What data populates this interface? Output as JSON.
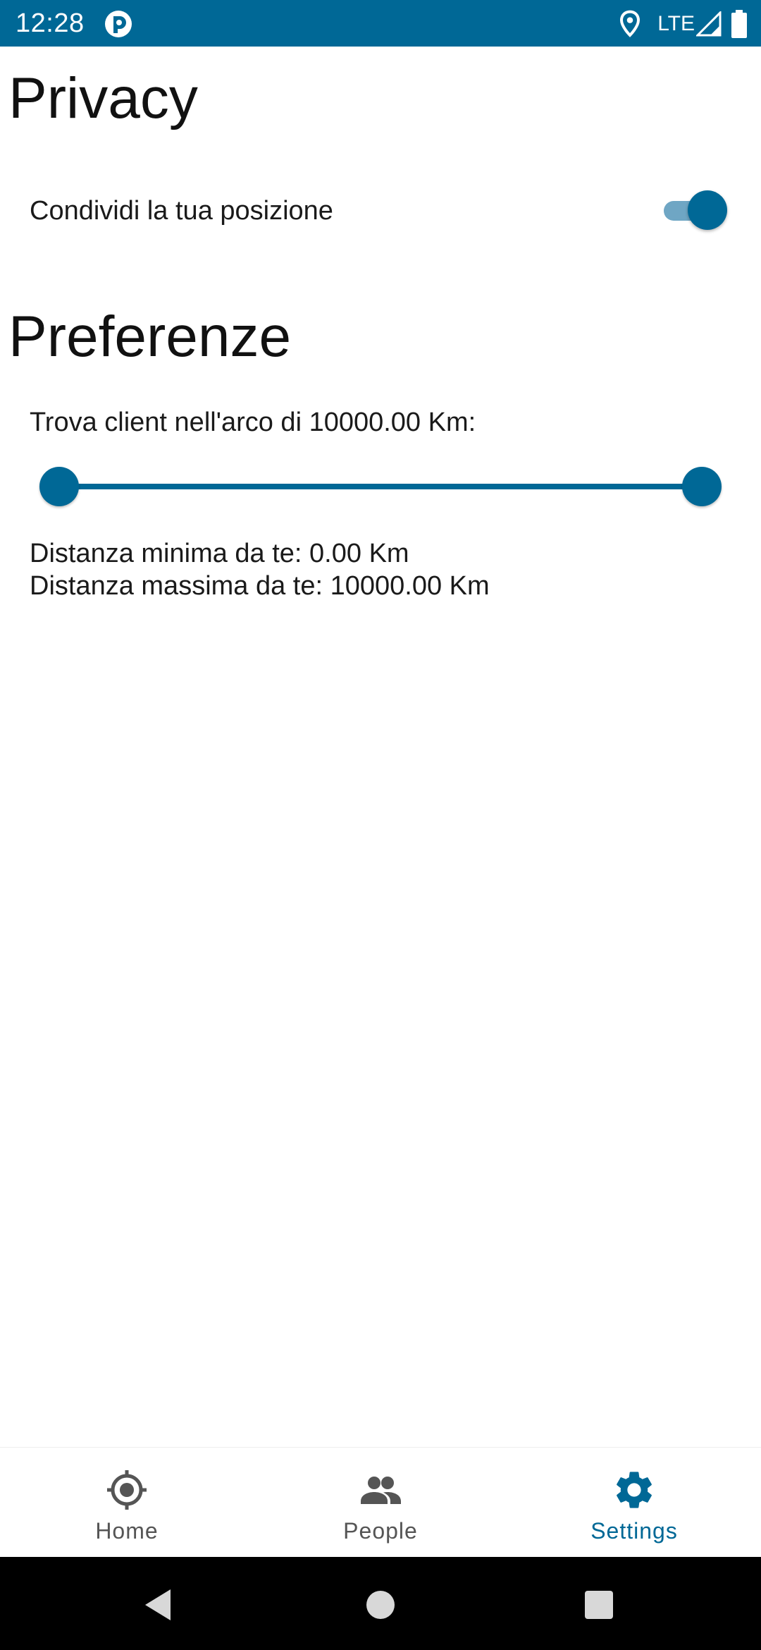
{
  "status_bar": {
    "time": "12:28",
    "network": "LTE",
    "background_color": "#006896"
  },
  "privacy": {
    "title": "Privacy",
    "share_location_label": "Condividi la tua posizione",
    "share_location_enabled": true
  },
  "preferences": {
    "title": "Preferenze",
    "range_label": "Trova client nell'arco di 10000.00 Km:",
    "range_min_fraction": 0,
    "range_max_fraction": 1,
    "min_distance_text": "Distanza minima da te: 0.00 Km",
    "max_distance_text": "Distanza massima da te: 10000.00 Km"
  },
  "bottom_nav": {
    "items": [
      {
        "label": "Home",
        "icon": "crosshair-icon",
        "active": false
      },
      {
        "label": "People",
        "icon": "people-icon",
        "active": false
      },
      {
        "label": "Settings",
        "icon": "gear-icon",
        "active": true
      }
    ],
    "active_color": "#006896",
    "inactive_color": "#555555"
  },
  "system_nav": {
    "buttons": [
      "back-icon",
      "home-circle-icon",
      "recents-square-icon"
    ]
  },
  "colors": {
    "accent": "#006896",
    "switch_track": "#6fa6c4"
  }
}
